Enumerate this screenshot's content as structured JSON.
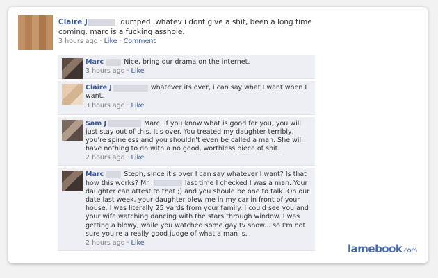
{
  "post": {
    "author": "Claire J",
    "text": "dumped. whatev i dont give a shit, been a long time coming. marc is a fucking asshole.",
    "time": "3 hours ago",
    "sep": "·",
    "like": "Like",
    "comment": "Comment"
  },
  "comments": [
    {
      "author": "Marc",
      "text": "Nice, bring our drama on the internet.",
      "time": "3 hours ago",
      "like": "Like"
    },
    {
      "author": "Claire J",
      "text": "whatever its over, i can say what I want when I want.",
      "time": "3 hours ago",
      "like": "Like"
    },
    {
      "author": "Sam J",
      "text": "Marc, if you know what is good for you, you will just stay out of this. It's over. You treated my daughter terribly, you're spineless and you shouldn't even be called a man. She will have nothing to do with a no good, worthless piece of shit.",
      "time": "2 hours ago",
      "like": "Like"
    },
    {
      "author": "Marc",
      "text_a": "Steph, since it's over I can say whatever I want? Is that how this works? Mr J",
      "text_b": "last time I checked I was a man. Your daughter can attest to that ;) and you should be one to talk. On our date last week, your daughter blew me in my car in front of your house. I was literally 25 yards from your family. I could see you and your wife watching dancing with the stars through window. I was getting a blowy, while you watched some gay tv show... so I'm not sure you're a really good judge of what a man is.",
      "time": "2 hours ago",
      "like": "Like"
    }
  ],
  "watermark": {
    "brand": "lamebook",
    "domain": ".com"
  }
}
